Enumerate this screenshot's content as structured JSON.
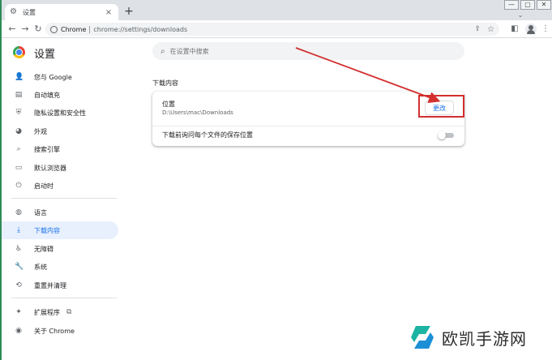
{
  "browser": {
    "tab_title": "设置",
    "tab_close": "×",
    "new_tab": "+",
    "window_controls": [
      "—",
      "▢",
      "✕"
    ],
    "tab_menu": "⌄",
    "toolbar": {
      "back": "←",
      "forward": "→",
      "reload": "↻",
      "site_label": "Chrome",
      "url": "chrome://settings/downloads"
    }
  },
  "settings": {
    "title": "设置",
    "search_placeholder": "在设置中搜索"
  },
  "sidebar": {
    "items": [
      {
        "label": "您与 Google",
        "icon": "person-icon",
        "glyph": "👤"
      },
      {
        "label": "自动填充",
        "icon": "clipboard-icon",
        "glyph": "▤"
      },
      {
        "label": "隐私设置和安全性",
        "icon": "shield-icon",
        "glyph": "⛨"
      },
      {
        "label": "外观",
        "icon": "palette-icon",
        "glyph": "◕"
      },
      {
        "label": "搜索引擎",
        "icon": "search-icon",
        "glyph": "⌕"
      },
      {
        "label": "默认浏览器",
        "icon": "browser-icon",
        "glyph": "▭"
      },
      {
        "label": "启动时",
        "icon": "power-icon",
        "glyph": "⏻"
      },
      {
        "label": "语言",
        "icon": "globe-icon",
        "glyph": "◍"
      },
      {
        "label": "下载内容",
        "icon": "download-icon",
        "glyph": "⤓"
      },
      {
        "label": "无障碍",
        "icon": "accessibility-icon",
        "glyph": "♿"
      },
      {
        "label": "系统",
        "icon": "wrench-icon",
        "glyph": "🔧"
      },
      {
        "label": "重置并清理",
        "icon": "reset-icon",
        "glyph": "⟲"
      },
      {
        "label": "扩展程序",
        "icon": "puzzle-icon",
        "glyph": "✦"
      },
      {
        "label": "关于 Chrome",
        "icon": "chrome-icon",
        "glyph": "◉"
      }
    ],
    "active_index": 8
  },
  "downloads": {
    "section_title": "下载内容",
    "location_label": "位置",
    "location_path": "D:\\Users\\mac\\Downloads",
    "change_button": "更改",
    "ask_label": "下载前询问每个文件的保存位置",
    "ask_enabled": false
  },
  "watermark": {
    "text": "欧凯手游网"
  },
  "colors": {
    "accent": "#1a73e8",
    "active_bg": "#e8f0fe",
    "annotation": "#d32f2f"
  }
}
